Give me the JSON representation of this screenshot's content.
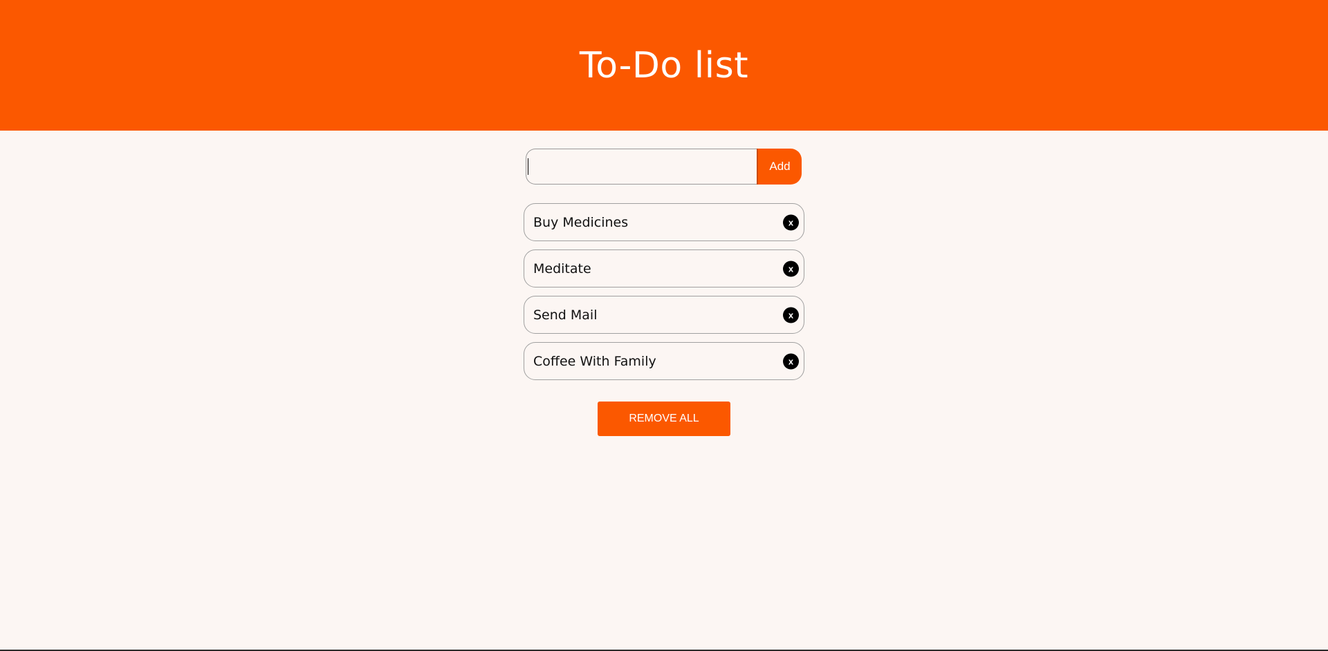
{
  "header": {
    "title": "To-Do list"
  },
  "composer": {
    "value": "",
    "placeholder": "",
    "add_label": "Add"
  },
  "tasks": [
    {
      "label": "Buy Medicines",
      "delete_label": "x"
    },
    {
      "label": "Meditate",
      "delete_label": "x"
    },
    {
      "label": "Send Mail",
      "delete_label": "x"
    },
    {
      "label": "Coffee With Family",
      "delete_label": "x"
    }
  ],
  "actions": {
    "remove_all_label": "REMOVE ALL"
  },
  "colors": {
    "accent": "#fb5800",
    "background": "#fcf6f3"
  }
}
